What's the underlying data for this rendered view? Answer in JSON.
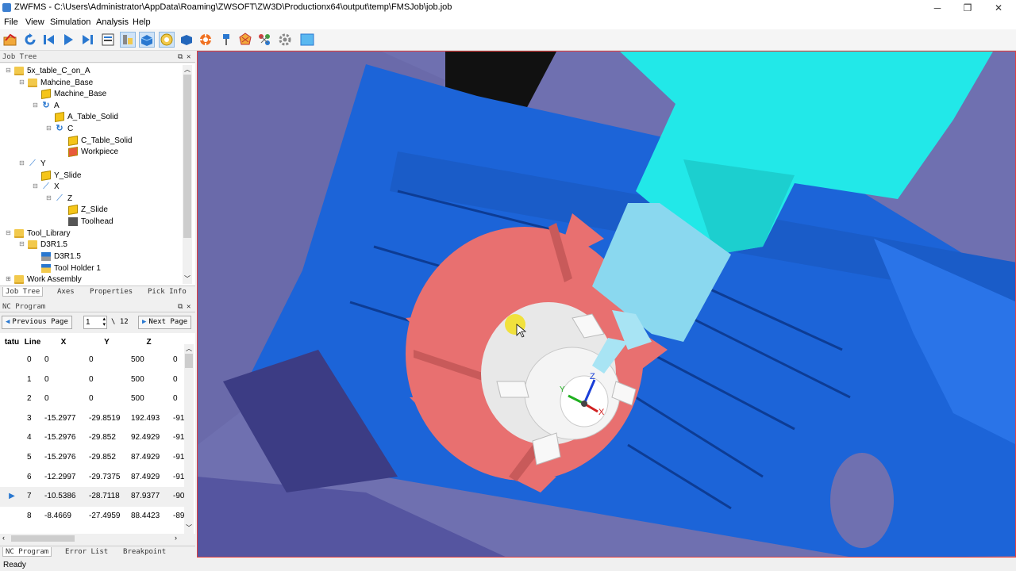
{
  "window": {
    "title": "ZWFMS - C:\\Users\\Administrator\\AppData\\Roaming\\ZWSOFT\\ZW3D\\Productionx64\\output\\temp\\FMSJob\\job.job"
  },
  "menu": {
    "items": [
      "File",
      "View",
      "Simulation",
      "Analysis",
      "Help"
    ]
  },
  "job_tree": {
    "header": "Job Tree",
    "items": [
      {
        "label": "5x_table_C_on_A",
        "type": "folder",
        "level": 0,
        "expander": "⊟"
      },
      {
        "label": "Mahcine_Base",
        "type": "folder",
        "level": 1,
        "expander": "⊟"
      },
      {
        "label": "Machine_Base",
        "type": "cube",
        "level": 2,
        "expander": ""
      },
      {
        "label": "A",
        "type": "rot",
        "level": 2,
        "expander": "⊟"
      },
      {
        "label": "A_Table_Solid",
        "type": "cube",
        "level": 3,
        "expander": ""
      },
      {
        "label": "C",
        "type": "rot",
        "level": 3,
        "expander": "⊟"
      },
      {
        "label": "C_Table_Solid",
        "type": "cube",
        "level": 4,
        "expander": ""
      },
      {
        "label": "Workpiece",
        "type": "cube-red",
        "level": 4,
        "expander": ""
      },
      {
        "label": "Y",
        "type": "lin",
        "level": 1,
        "expander": "⊟"
      },
      {
        "label": "Y_Slide",
        "type": "cube",
        "level": 2,
        "expander": ""
      },
      {
        "label": "X",
        "type": "lin",
        "level": 2,
        "expander": "⊟"
      },
      {
        "label": "Z",
        "type": "lin",
        "level": 3,
        "expander": "⊟"
      },
      {
        "label": "Z_Slide",
        "type": "cube",
        "level": 4,
        "expander": ""
      },
      {
        "label": "Toolhead",
        "type": "head",
        "level": 4,
        "expander": ""
      },
      {
        "label": "Tool_Library",
        "type": "folder",
        "level": 0,
        "expander": "⊟"
      },
      {
        "label": "D3R1.5",
        "type": "folder",
        "level": 1,
        "expander": "⊟"
      },
      {
        "label": "D3R1.5",
        "type": "tool",
        "level": 2,
        "expander": ""
      },
      {
        "label": "Tool Holder 1",
        "type": "holder",
        "level": 2,
        "expander": ""
      },
      {
        "label": "Work Assembly",
        "type": "folder",
        "level": 0,
        "expander": "⊞"
      }
    ],
    "tabs": [
      "Job Tree",
      "Axes",
      "Properties",
      "Pick Info"
    ]
  },
  "nc_program": {
    "header": "NC Program",
    "prev_label": "Previous Page",
    "next_label": "Next Page",
    "page": "1",
    "total": "\\ 12",
    "columns": [
      "tatu",
      "Line",
      "X",
      "Y",
      "Z",
      ""
    ],
    "rows": [
      {
        "status": "",
        "line": "0",
        "x": "0",
        "y": "0",
        "z": "500",
        "a": "0"
      },
      {
        "status": "",
        "line": "1",
        "x": "0",
        "y": "0",
        "z": "500",
        "a": "0"
      },
      {
        "status": "",
        "line": "2",
        "x": "0",
        "y": "0",
        "z": "500",
        "a": "0"
      },
      {
        "status": "",
        "line": "3",
        "x": "-15.2977",
        "y": "-29.8519",
        "z": "192.493",
        "a": "-91"
      },
      {
        "status": "",
        "line": "4",
        "x": "-15.2976",
        "y": "-29.852",
        "z": "92.4929",
        "a": "-91"
      },
      {
        "status": "",
        "line": "5",
        "x": "-15.2976",
        "y": "-29.852",
        "z": "87.4929",
        "a": "-91"
      },
      {
        "status": "",
        "line": "6",
        "x": "-12.2997",
        "y": "-29.7375",
        "z": "87.4929",
        "a": "-91"
      },
      {
        "status": "▶",
        "line": "7",
        "x": "-10.5386",
        "y": "-28.7118",
        "z": "87.9377",
        "a": "-90"
      },
      {
        "status": "",
        "line": "8",
        "x": "-8.4669",
        "y": "-27.4959",
        "z": "88.4423",
        "a": "-89"
      }
    ],
    "selected_index": 7,
    "tabs": [
      "NC Program",
      "Error List",
      "Breakpoint"
    ]
  },
  "viewport": {
    "axis_labels": {
      "x": "X",
      "y": "Y",
      "z": "Z"
    },
    "colors": {
      "background": "#6f6fb0",
      "table": "#1e6fe8",
      "workpiece": "#e86f6f",
      "spindle": "#22e8e8",
      "chuck": "#e8e8e8"
    }
  },
  "status": {
    "text": "Ready"
  },
  "colors": {
    "accent": "#2a78d0",
    "viewport_border": "#e04040"
  }
}
